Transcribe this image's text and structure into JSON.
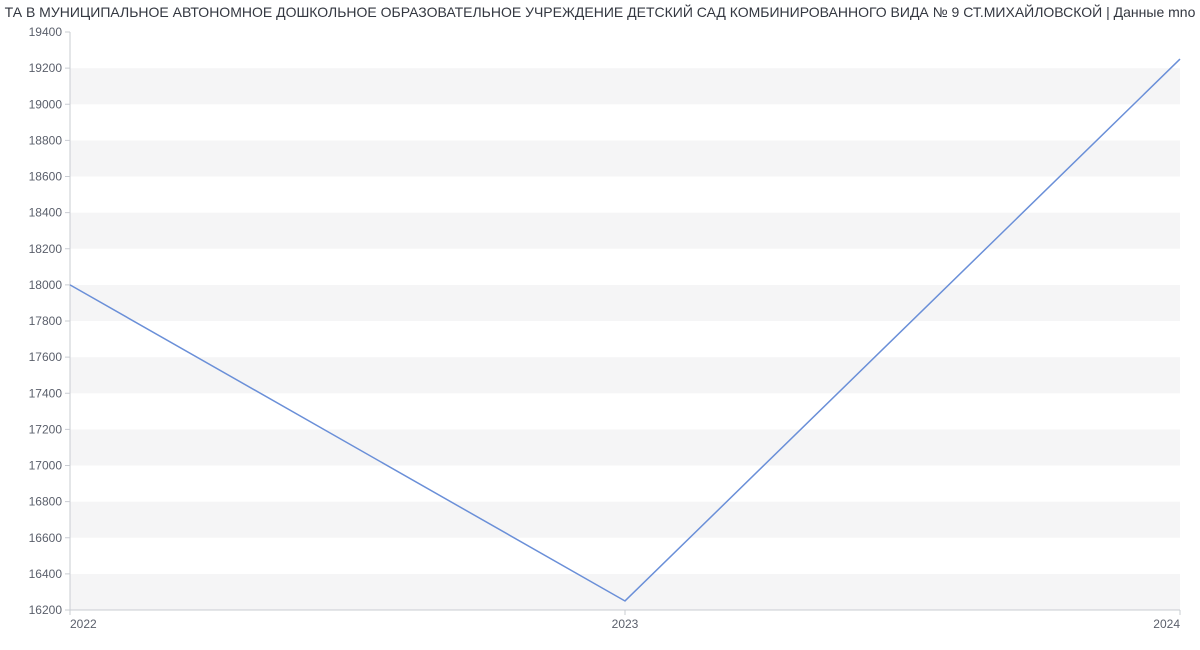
{
  "title": "ТА В МУНИЦИПАЛЬНОЕ АВТОНОМНОЕ ДОШКОЛЬНОЕ ОБРАЗОВАТЕЛЬНОЕ УЧРЕЖДЕНИЕ ДЕТСКИЙ САД КОМБИНИРОВАННОГО ВИДА № 9 СТ.МИХАЙЛОВСКОЙ | Данные mno",
  "chart_data": {
    "type": "line",
    "x": [
      2022,
      2023,
      2024
    ],
    "values": [
      18000,
      16250,
      19250
    ],
    "xlabel": "",
    "ylabel": "",
    "ylim": [
      16200,
      19400
    ],
    "yticks": [
      16200,
      16400,
      16600,
      16800,
      17000,
      17200,
      17400,
      17600,
      17800,
      18000,
      18200,
      18400,
      18600,
      18800,
      19000,
      19200,
      19400
    ],
    "xticks": [
      2022,
      2023,
      2024
    ],
    "grid": true
  }
}
